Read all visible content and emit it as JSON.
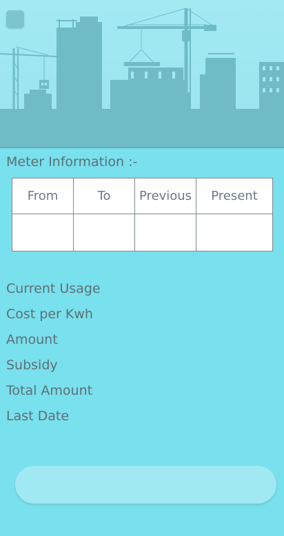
{
  "header": {
    "illustration": "construction-skyline-illustration",
    "back_icon": "back-icon"
  },
  "meter_section": {
    "title": "Meter Information :-",
    "columns": [
      "From",
      "To",
      "Previous",
      "Present"
    ],
    "row": [
      "",
      "",
      "",
      ""
    ]
  },
  "info_items": [
    {
      "label": "Current Usage"
    },
    {
      "label": "Cost per Kwh"
    },
    {
      "label": "Amount"
    },
    {
      "label": "Subsidy"
    },
    {
      "label": "Total Amount"
    },
    {
      "label": "Last Date"
    }
  ],
  "action_button": {
    "label": ""
  },
  "colors": {
    "background": "#79e0ee",
    "header": "#a3e9f2",
    "silhouette": "#6fbcc6",
    "table": "#ffffff",
    "text": "#5e6f73",
    "button": "#a0e8f2"
  }
}
